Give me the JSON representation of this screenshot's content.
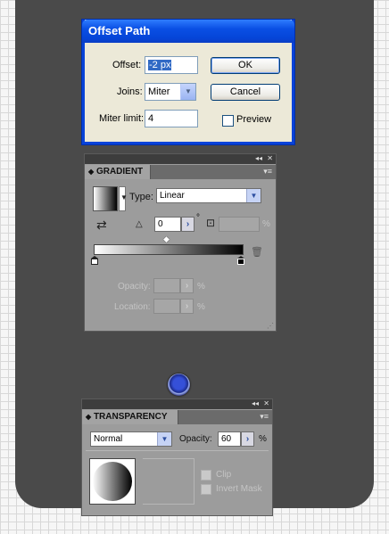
{
  "dialog": {
    "title": "Offset Path",
    "offset_label": "Offset:",
    "offset_value": "-2 px",
    "joins_label": "Joins:",
    "joins_value": "Miter",
    "miter_label": "Miter limit:",
    "miter_value": "4",
    "ok_label": "OK",
    "cancel_label": "Cancel",
    "preview_label": "Preview"
  },
  "gradient_panel": {
    "tab_label": "GRADIENT",
    "type_label": "Type:",
    "type_value": "Linear",
    "angle_value": "0",
    "degree_symbol": "°",
    "aspect_unit": "%",
    "opacity_label": "Opacity:",
    "opacity_unit": "%",
    "location_label": "Location:",
    "location_unit": "%",
    "collapse_glyph": "◂◂",
    "close_glyph": "✕",
    "menu_glyph": "▾≡"
  },
  "transparency_panel": {
    "tab_label": "TRANSPARENCY",
    "blend_mode": "Normal",
    "opacity_label": "Opacity:",
    "opacity_value": "60",
    "opacity_unit": "%",
    "clip_label": "Clip",
    "invert_mask_label": "Invert Mask",
    "collapse_glyph": "◂◂",
    "close_glyph": "✕",
    "menu_glyph": "▾≡"
  },
  "colors": {
    "artboard": "#4a4a4a",
    "xp_title_blue": "#0a4fe4",
    "panel_gray": "#9c9c9c"
  }
}
